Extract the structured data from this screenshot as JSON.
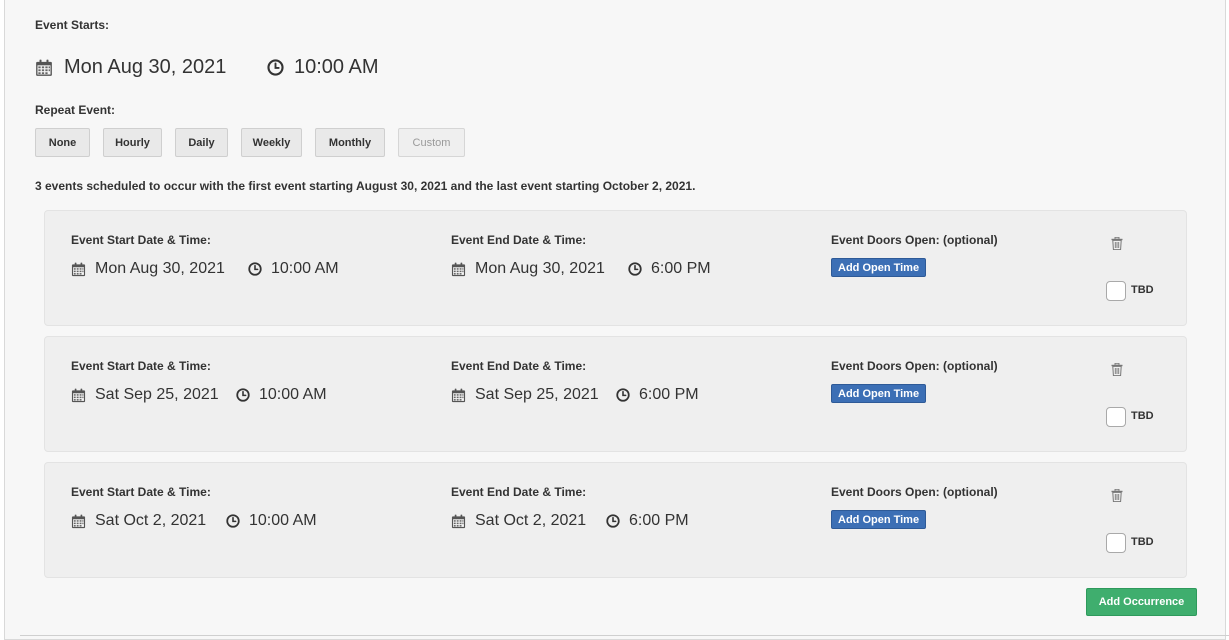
{
  "event_starts": {
    "label": "Event Starts:",
    "date": "Mon Aug 30, 2021",
    "time": "10:00 AM"
  },
  "repeat": {
    "label": "Repeat Event:",
    "options": [
      "None",
      "Hourly",
      "Daily",
      "Weekly",
      "Monthly",
      "Custom"
    ],
    "disabled": "Custom"
  },
  "summary": "3 events scheduled to occur with the first event starting August 30, 2021 and the last event starting October 2, 2021.",
  "occurrences": [
    {
      "start_label": "Event Start Date & Time:",
      "start_date": "Mon Aug 30, 2021",
      "start_time": "10:00 AM",
      "end_label": "Event End Date & Time:",
      "end_date": "Mon Aug 30, 2021",
      "end_time": "6:00 PM",
      "doors_label": "Event Doors Open: (optional)",
      "add_open_time": "Add Open Time",
      "tbd_label": "TBD",
      "tbd_checked": false
    },
    {
      "start_label": "Event Start Date & Time:",
      "start_date": "Sat Sep 25, 2021",
      "start_time": "10:00 AM",
      "end_label": "Event End Date & Time:",
      "end_date": "Sat Sep 25, 2021",
      "end_time": "6:00 PM",
      "doors_label": "Event Doors Open: (optional)",
      "add_open_time": "Add Open Time",
      "tbd_label": "TBD",
      "tbd_checked": false
    },
    {
      "start_label": "Event Start Date & Time:",
      "start_date": "Sat Oct 2, 2021",
      "start_time": "10:00 AM",
      "end_label": "Event End Date & Time:",
      "end_date": "Sat Oct 2, 2021",
      "end_time": "6:00 PM",
      "doors_label": "Event Doors Open: (optional)",
      "add_open_time": "Add Open Time",
      "tbd_label": "TBD",
      "tbd_checked": false
    }
  ],
  "add_occurrence": "Add Occurrence",
  "icons": {
    "date": "calendar-icon",
    "time": "clock-icon",
    "delete": "trash-icon"
  },
  "colors": {
    "primary": "#3c6fb5",
    "success": "#3fae6e",
    "panel": "#f7f7f7",
    "card": "#efefef"
  }
}
